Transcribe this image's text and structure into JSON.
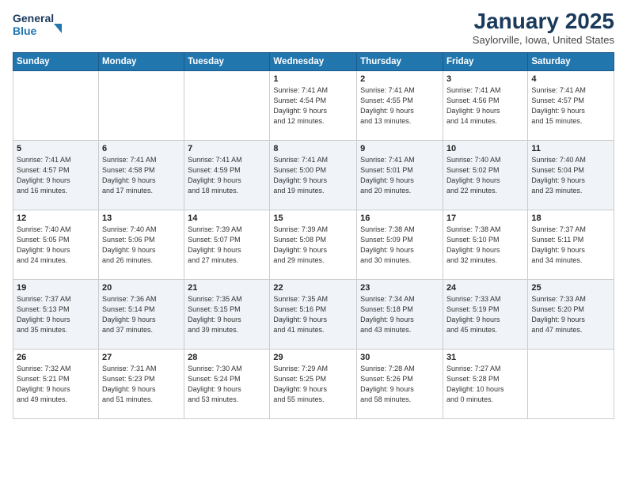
{
  "header": {
    "logo_line1": "General",
    "logo_line2": "Blue",
    "month": "January 2025",
    "location": "Saylorville, Iowa, United States"
  },
  "days_of_week": [
    "Sunday",
    "Monday",
    "Tuesday",
    "Wednesday",
    "Thursday",
    "Friday",
    "Saturday"
  ],
  "weeks": [
    [
      {
        "day": "",
        "info": ""
      },
      {
        "day": "",
        "info": ""
      },
      {
        "day": "",
        "info": ""
      },
      {
        "day": "1",
        "info": "Sunrise: 7:41 AM\nSunset: 4:54 PM\nDaylight: 9 hours\nand 12 minutes."
      },
      {
        "day": "2",
        "info": "Sunrise: 7:41 AM\nSunset: 4:55 PM\nDaylight: 9 hours\nand 13 minutes."
      },
      {
        "day": "3",
        "info": "Sunrise: 7:41 AM\nSunset: 4:56 PM\nDaylight: 9 hours\nand 14 minutes."
      },
      {
        "day": "4",
        "info": "Sunrise: 7:41 AM\nSunset: 4:57 PM\nDaylight: 9 hours\nand 15 minutes."
      }
    ],
    [
      {
        "day": "5",
        "info": "Sunrise: 7:41 AM\nSunset: 4:57 PM\nDaylight: 9 hours\nand 16 minutes."
      },
      {
        "day": "6",
        "info": "Sunrise: 7:41 AM\nSunset: 4:58 PM\nDaylight: 9 hours\nand 17 minutes."
      },
      {
        "day": "7",
        "info": "Sunrise: 7:41 AM\nSunset: 4:59 PM\nDaylight: 9 hours\nand 18 minutes."
      },
      {
        "day": "8",
        "info": "Sunrise: 7:41 AM\nSunset: 5:00 PM\nDaylight: 9 hours\nand 19 minutes."
      },
      {
        "day": "9",
        "info": "Sunrise: 7:41 AM\nSunset: 5:01 PM\nDaylight: 9 hours\nand 20 minutes."
      },
      {
        "day": "10",
        "info": "Sunrise: 7:40 AM\nSunset: 5:02 PM\nDaylight: 9 hours\nand 22 minutes."
      },
      {
        "day": "11",
        "info": "Sunrise: 7:40 AM\nSunset: 5:04 PM\nDaylight: 9 hours\nand 23 minutes."
      }
    ],
    [
      {
        "day": "12",
        "info": "Sunrise: 7:40 AM\nSunset: 5:05 PM\nDaylight: 9 hours\nand 24 minutes."
      },
      {
        "day": "13",
        "info": "Sunrise: 7:40 AM\nSunset: 5:06 PM\nDaylight: 9 hours\nand 26 minutes."
      },
      {
        "day": "14",
        "info": "Sunrise: 7:39 AM\nSunset: 5:07 PM\nDaylight: 9 hours\nand 27 minutes."
      },
      {
        "day": "15",
        "info": "Sunrise: 7:39 AM\nSunset: 5:08 PM\nDaylight: 9 hours\nand 29 minutes."
      },
      {
        "day": "16",
        "info": "Sunrise: 7:38 AM\nSunset: 5:09 PM\nDaylight: 9 hours\nand 30 minutes."
      },
      {
        "day": "17",
        "info": "Sunrise: 7:38 AM\nSunset: 5:10 PM\nDaylight: 9 hours\nand 32 minutes."
      },
      {
        "day": "18",
        "info": "Sunrise: 7:37 AM\nSunset: 5:11 PM\nDaylight: 9 hours\nand 34 minutes."
      }
    ],
    [
      {
        "day": "19",
        "info": "Sunrise: 7:37 AM\nSunset: 5:13 PM\nDaylight: 9 hours\nand 35 minutes."
      },
      {
        "day": "20",
        "info": "Sunrise: 7:36 AM\nSunset: 5:14 PM\nDaylight: 9 hours\nand 37 minutes."
      },
      {
        "day": "21",
        "info": "Sunrise: 7:35 AM\nSunset: 5:15 PM\nDaylight: 9 hours\nand 39 minutes."
      },
      {
        "day": "22",
        "info": "Sunrise: 7:35 AM\nSunset: 5:16 PM\nDaylight: 9 hours\nand 41 minutes."
      },
      {
        "day": "23",
        "info": "Sunrise: 7:34 AM\nSunset: 5:18 PM\nDaylight: 9 hours\nand 43 minutes."
      },
      {
        "day": "24",
        "info": "Sunrise: 7:33 AM\nSunset: 5:19 PM\nDaylight: 9 hours\nand 45 minutes."
      },
      {
        "day": "25",
        "info": "Sunrise: 7:33 AM\nSunset: 5:20 PM\nDaylight: 9 hours\nand 47 minutes."
      }
    ],
    [
      {
        "day": "26",
        "info": "Sunrise: 7:32 AM\nSunset: 5:21 PM\nDaylight: 9 hours\nand 49 minutes."
      },
      {
        "day": "27",
        "info": "Sunrise: 7:31 AM\nSunset: 5:23 PM\nDaylight: 9 hours\nand 51 minutes."
      },
      {
        "day": "28",
        "info": "Sunrise: 7:30 AM\nSunset: 5:24 PM\nDaylight: 9 hours\nand 53 minutes."
      },
      {
        "day": "29",
        "info": "Sunrise: 7:29 AM\nSunset: 5:25 PM\nDaylight: 9 hours\nand 55 minutes."
      },
      {
        "day": "30",
        "info": "Sunrise: 7:28 AM\nSunset: 5:26 PM\nDaylight: 9 hours\nand 58 minutes."
      },
      {
        "day": "31",
        "info": "Sunrise: 7:27 AM\nSunset: 5:28 PM\nDaylight: 10 hours\nand 0 minutes."
      },
      {
        "day": "",
        "info": ""
      }
    ]
  ]
}
